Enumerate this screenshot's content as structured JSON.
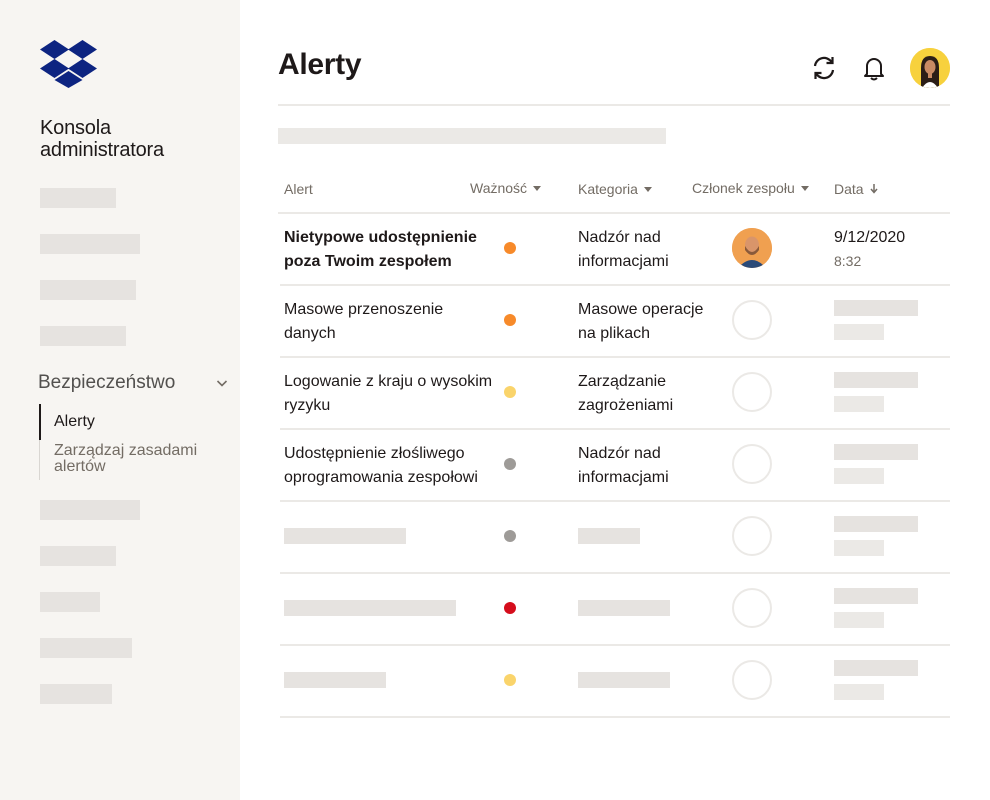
{
  "brand": {
    "logo_icon": "dropbox-logo-icon",
    "console_title_line1": "Konsola",
    "console_title_line2": "administratora",
    "color": "#0d2481"
  },
  "sidebar": {
    "section_label": "Bezpieczeństwo",
    "subnav": [
      {
        "label": "Alerty",
        "active": true
      },
      {
        "label": "Zarządzaj zasadami alertów",
        "active": false
      }
    ]
  },
  "header": {
    "title": "Alerty",
    "icons": [
      "refresh-icon",
      "bell-icon",
      "user-avatar"
    ]
  },
  "table": {
    "columns": [
      "Alert",
      "Ważność",
      "Kategoria",
      "Członek zespołu",
      "Data"
    ],
    "rows": [
      {
        "alert": "Nietypowe udostępnienie poza Twoim zespołem",
        "severity_color": "#f78a2a",
        "category": "Nadzór nad informacjami",
        "date": "9/12/2020",
        "time": "8:32"
      },
      {
        "alert": "Masowe przenoszenie danych",
        "severity_color": "#f78a2a",
        "category": "Masowe operacje na plikach"
      },
      {
        "alert": "Logowanie z kraju o wysokim ryzyku",
        "severity_color": "#fad46b",
        "category": "Zarządzanie zagrożeniami"
      },
      {
        "alert": "Udostępnienie złośliwego oprogramowania zespołowi",
        "severity_color": "#9e9b98",
        "category": "Nadzór nad informacjami"
      },
      {
        "severity_color": "#9e9b98"
      },
      {
        "severity_color": "#d50d1c"
      },
      {
        "severity_color": "#fad46b"
      }
    ]
  }
}
